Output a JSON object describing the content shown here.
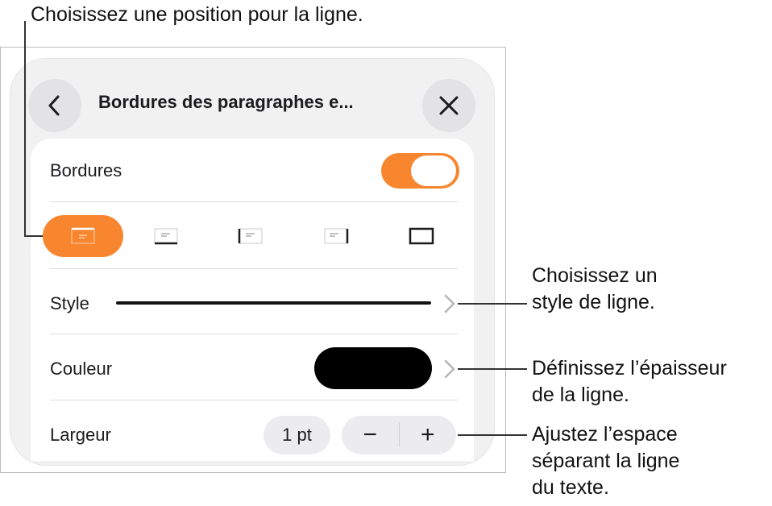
{
  "callouts": {
    "position": "Choisissez une position pour la ligne.",
    "style": [
      "Choisissez un",
      "style de ligne."
    ],
    "color": [
      "Définissez l’épaisseur",
      "de la ligne."
    ],
    "width": [
      "Ajustez l’espace",
      "séparant la ligne",
      "du texte."
    ]
  },
  "header": {
    "title": "Bordures des paragraphes e...",
    "back_icon": "chevron-left-icon",
    "close_icon": "close-icon"
  },
  "borders": {
    "label": "Bordures",
    "enabled": true
  },
  "positions": {
    "selected_index": 0,
    "items": [
      "top-border-icon",
      "bottom-border-icon",
      "left-border-icon",
      "right-border-icon",
      "all-borders-icon"
    ]
  },
  "style": {
    "label": "Style"
  },
  "color": {
    "label": "Couleur",
    "value": "#000000"
  },
  "width": {
    "label": "Largeur",
    "value": "1 pt",
    "minus": "−",
    "plus": "+"
  },
  "colors": {
    "accent": "#f7862e",
    "panel": "#f1f1f2",
    "card": "#ffffff"
  }
}
